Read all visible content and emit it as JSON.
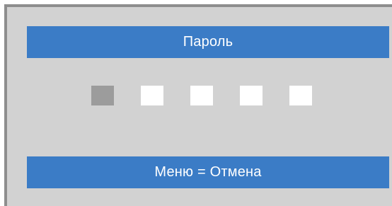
{
  "dialog": {
    "title": "Пароль",
    "footer_hint": "Меню = Отмена"
  },
  "pin": {
    "length": 5,
    "active_index": 0,
    "colors": {
      "active": "#9c9c9c",
      "empty": "#ffffff"
    }
  },
  "colors": {
    "bar": "#3b7cc6",
    "panel": "#d2d2d2",
    "frame": "#8e8e8e"
  }
}
